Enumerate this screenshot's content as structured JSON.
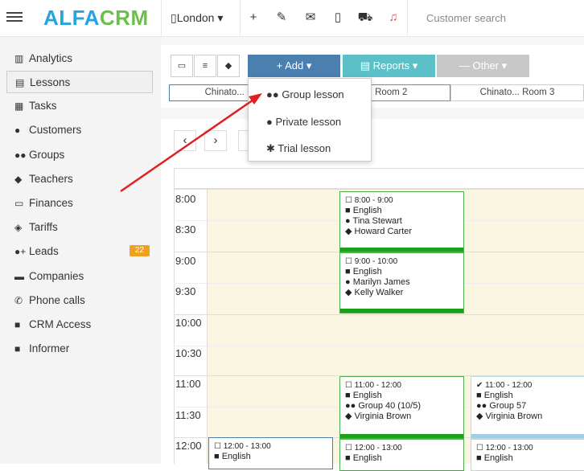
{
  "logo": {
    "part1": "ALFA",
    "part2": "CRM"
  },
  "topbar": {
    "city": "London",
    "city_icon": "building-icon",
    "add_icon": "plus-icon",
    "tools_icon": "wrench-icon",
    "mail_icon": "envelope-icon",
    "phone_icon": "mobile-icon",
    "cart_icon": "cart-icon",
    "bell_icon": "bell-icon",
    "search_placeholder": "Customer search",
    "bell_color": "#e05050"
  },
  "sidebar": {
    "items": [
      {
        "label": "Analytics",
        "icon": "analytics-icon"
      },
      {
        "label": "Lessons",
        "icon": "calendar-icon"
      },
      {
        "label": "Tasks",
        "icon": "tasks-icon"
      },
      {
        "label": "Customers",
        "icon": "user-icon"
      },
      {
        "label": "Groups",
        "icon": "users-icon"
      },
      {
        "label": "Teachers",
        "icon": "graduation-cap-icon"
      },
      {
        "label": "Finances",
        "icon": "money-icon"
      },
      {
        "label": "Tariffs",
        "icon": "tag-icon"
      },
      {
        "label": "Leads",
        "icon": "user-plus-icon",
        "badge": "22"
      },
      {
        "label": "Companies",
        "icon": "briefcase-icon"
      },
      {
        "label": "Phone calls",
        "icon": "phone-icon"
      },
      {
        "label": "CRM Access",
        "icon": "lock-icon"
      },
      {
        "label": "Informer",
        "icon": "book-icon"
      }
    ]
  },
  "toolbar": {
    "add": "+ Add ▾",
    "reports": "Reports ▾",
    "other": "Other ▾",
    "add_color": "#4a7fb0",
    "reports_color": "#5bc0c8",
    "other_color": "#c8c8c8"
  },
  "rooms": [
    "Chinato... R",
    "Chinato... Room 2",
    "Chinato... Room 3"
  ],
  "dropdown": {
    "items": [
      "Group lesson",
      "Private lesson",
      "Trial lesson"
    ]
  },
  "times": [
    "8:00",
    "8:30",
    "9:00",
    "9:30",
    "10:00",
    "10:30",
    "11:00",
    "11:30",
    "12:00"
  ],
  "events": [
    {
      "time": "8:00 - 9:00",
      "subject": "English",
      "who": "Tina Stewart",
      "teacher": "Howard Carter"
    },
    {
      "time": "9:00 - 10:00",
      "subject": "English",
      "who": "Marilyn James",
      "teacher": "Kelly Walker"
    },
    {
      "time": "11:00 - 12:00",
      "subject": "English",
      "who": "Group 40 (10/5)",
      "teacher": "Virginia Brown"
    },
    {
      "time": "11:00 - 12:00",
      "subject": "English",
      "who": "Group 57",
      "teacher": "Virginia Brown"
    },
    {
      "time": "12:00 - 13:00",
      "subject": "English"
    },
    {
      "time": "12:00 - 13:00",
      "subject": "English"
    },
    {
      "time": "12:00 - 13:00",
      "subject": "English"
    }
  ]
}
